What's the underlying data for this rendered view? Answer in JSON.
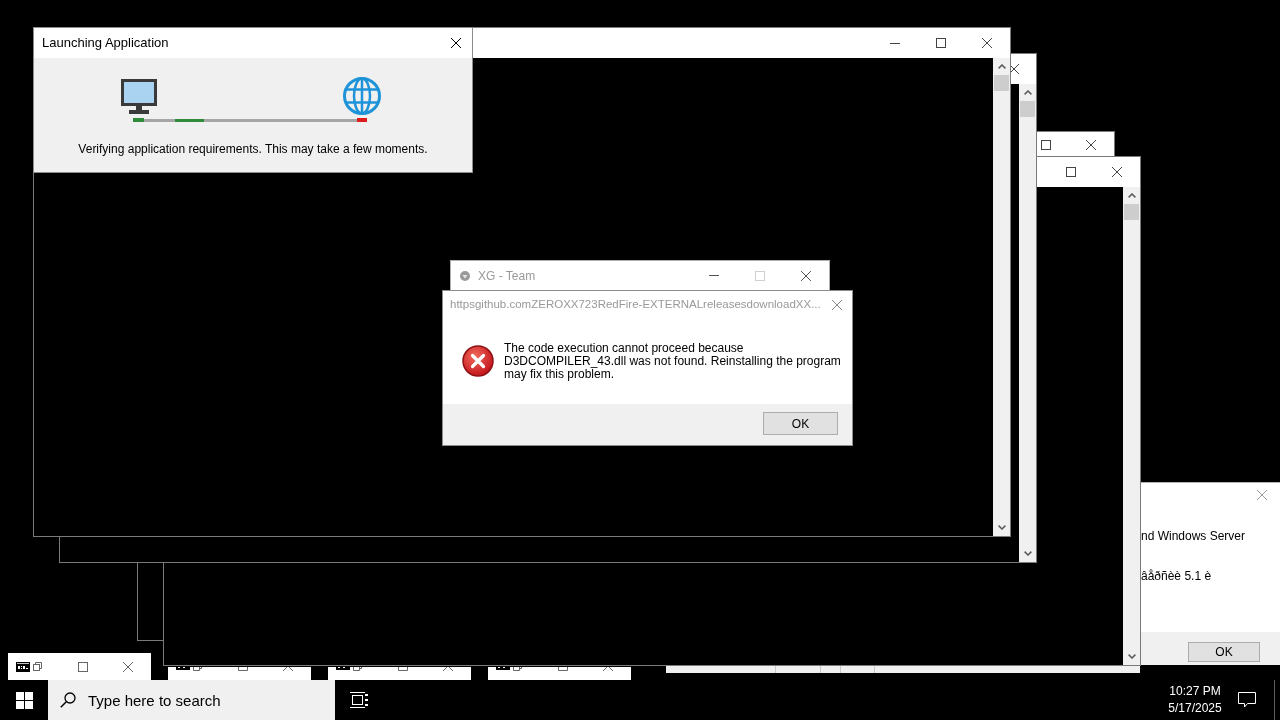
{
  "launching_dialog": {
    "title": "Launching Application",
    "active": true,
    "message": "Verifying application requirements. This may take a few moments."
  },
  "xg_window": {
    "title": "XG - Team",
    "active": false,
    "maximize_disabled": true
  },
  "error_dialog": {
    "title": "httpsgithub.comZEROXX723RedFire-EXTERNALreleasesdownloadXX...",
    "active": false,
    "message_lines": [
      "The code execution cannot proceed because",
      "D3DCOMPILER_43.dll was not found. Reinstalling the program",
      "may fix this problem."
    ],
    "button": "OK"
  },
  "message_box": {
    "lines": [
      "nd Windows Server",
      "âåðñèè 5.1 è"
    ],
    "button": "OK"
  },
  "taskbar": {
    "search": {
      "placeholder": "Type here to search"
    },
    "clock": {
      "time": "10:27 PM",
      "date": "5/17/2025"
    }
  }
}
